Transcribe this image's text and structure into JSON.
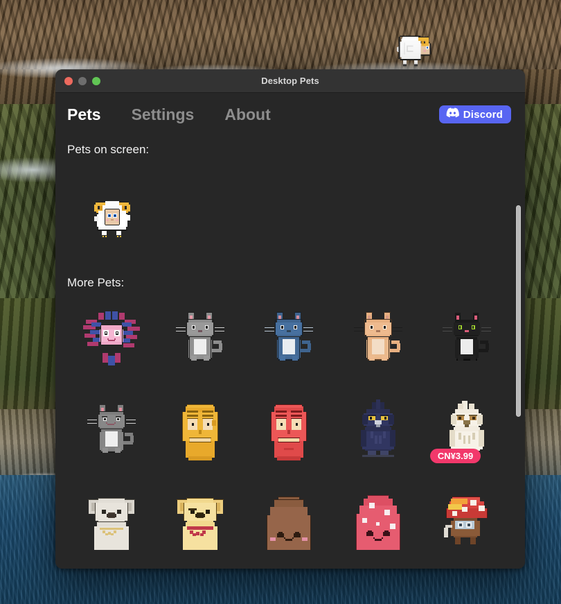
{
  "window": {
    "title": "Desktop Pets",
    "traffic_lights": [
      {
        "name": "close",
        "color": "#ed6a5e"
      },
      {
        "name": "minimize",
        "color": "#6e6e6e"
      },
      {
        "name": "maximize",
        "color": "#61c554"
      }
    ]
  },
  "nav": {
    "tabs": [
      {
        "label": "Pets",
        "active": true
      },
      {
        "label": "Settings",
        "active": false
      },
      {
        "label": "About",
        "active": false
      }
    ],
    "discord": {
      "label": "Discord",
      "icon": "discord-icon",
      "color": "#5865f2"
    }
  },
  "sections": {
    "on_screen_label": "Pets on screen:",
    "more_pets_label": "More Pets:"
  },
  "on_screen_pets": [
    {
      "name": "ram",
      "icon": "ram-sprite"
    }
  ],
  "desktop_pet": {
    "name": "ram",
    "icon": "ram-sprite"
  },
  "more_pets": [
    {
      "name": "axolotl",
      "icon": "axolotl-sprite",
      "price": null
    },
    {
      "name": "gray-cat",
      "icon": "gray-cat-sprite",
      "price": null
    },
    {
      "name": "blue-cat",
      "icon": "blue-cat-sprite",
      "price": null
    },
    {
      "name": "orange-cat",
      "icon": "orange-cat-sprite",
      "price": null
    },
    {
      "name": "black-cat",
      "icon": "black-cat-sprite",
      "price": null
    },
    {
      "name": "grumpy-gray-cat",
      "icon": "grumpy-cat-sprite",
      "price": null
    },
    {
      "name": "yellow-head",
      "icon": "yellow-head-sprite",
      "price": null
    },
    {
      "name": "red-head",
      "icon": "red-head-sprite",
      "price": null
    },
    {
      "name": "owl",
      "icon": "owl-sprite",
      "price": null
    },
    {
      "name": "white-owl",
      "icon": "white-owl-sprite",
      "price": "CN¥3.99"
    },
    {
      "name": "gray-koala",
      "icon": "gray-koala-sprite",
      "price": null
    },
    {
      "name": "yellow-bear",
      "icon": "yellow-bear-sprite",
      "price": null
    },
    {
      "name": "brown-blob",
      "icon": "brown-blob-sprite",
      "price": null
    },
    {
      "name": "pink-mushroom-blob",
      "icon": "pink-blob-sprite",
      "price": null
    },
    {
      "name": "mushroom-creature",
      "icon": "mushroom-sprite",
      "price": null
    }
  ],
  "colors": {
    "window_bg": "#272727",
    "titlebar_bg": "#333333",
    "accent_discord": "#5865f2",
    "price_badge": "#f2386b",
    "tab_active": "#ffffff",
    "tab_inactive": "#8d8d8d"
  }
}
